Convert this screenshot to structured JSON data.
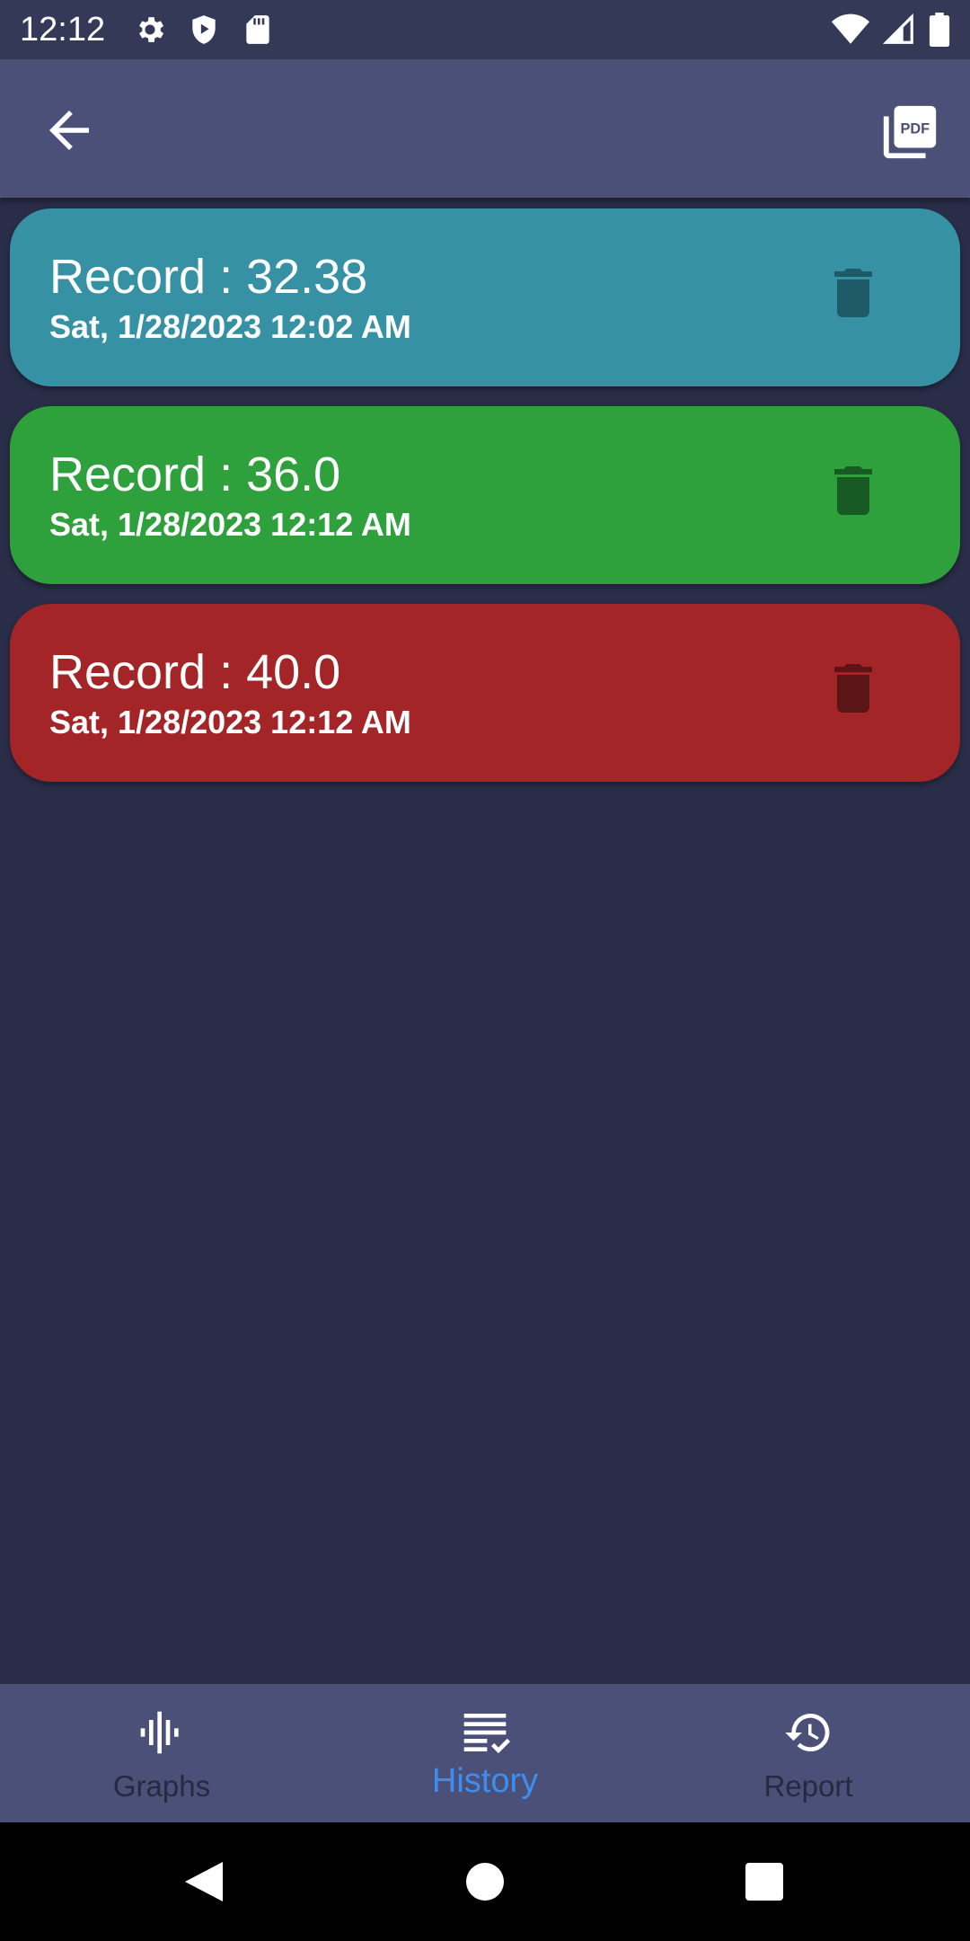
{
  "status_bar": {
    "time": "12:12"
  },
  "records": [
    {
      "title": "Record : 32.38",
      "date": "Sat, 1/28/2023 12:02 AM",
      "color": "#3591a3",
      "icon_color": "#1e5a68"
    },
    {
      "title": "Record : 36.0",
      "date": "Sat, 1/28/2023 12:12 AM",
      "color": "#2ea03c",
      "icon_color": "#185a23"
    },
    {
      "title": "Record : 40.0",
      "date": "Sat, 1/28/2023 12:12 AM",
      "color": "#a32528",
      "icon_color": "#5c1517"
    }
  ],
  "bottom_nav": [
    {
      "label": "Graphs",
      "icon": "waveform-icon",
      "active": false
    },
    {
      "label": "History",
      "icon": "checklist-icon",
      "active": true
    },
    {
      "label": "Report",
      "icon": "history-clock-icon",
      "active": false
    }
  ],
  "colors": {
    "background": "#292d47",
    "app_bar": "#4b5079",
    "active_tab": "#3d8ef0",
    "inactive_tab": "#262a3f"
  }
}
